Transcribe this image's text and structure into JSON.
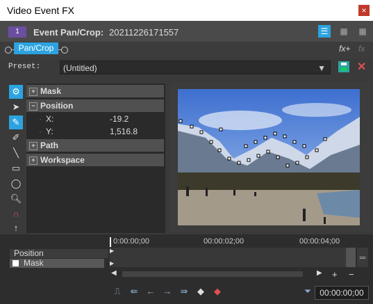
{
  "window": {
    "title": "Video Event FX",
    "close_label": "×"
  },
  "header": {
    "badge": "1",
    "effect_name": "Event Pan/Crop:",
    "event_id": "20211226171557"
  },
  "chain": {
    "button_label": "Pan/Crop",
    "fx_add": "fx+",
    "fx_remove": "fx"
  },
  "preset": {
    "label": "Preset:",
    "value": "(Untitled)",
    "arrow": "▼"
  },
  "properties": {
    "sections": [
      "Mask",
      "Position",
      "Path",
      "Workspace"
    ],
    "position": {
      "x_label": "X:",
      "x_value": "-19.2",
      "y_label": "Y:",
      "y_value": "1,516.8"
    }
  },
  "timeline": {
    "tracks": [
      "Position",
      "Mask"
    ],
    "ticks": [
      "0:00:00;00",
      "00:00:02;00",
      "00:00:04;00"
    ],
    "timecode": "00:00:00;00",
    "plus_label": "+",
    "minus_label": "−"
  },
  "colors": {
    "accent": "#2ca3e0",
    "title_bg": "#ffffff",
    "panel_bg": "#3a3a3a",
    "close_red": "#e05050"
  },
  "icons": {
    "tools": [
      "gear-icon",
      "pointer-icon",
      "pen-icon",
      "bezier-icon",
      "line-icon",
      "rectangle-icon",
      "ellipse-icon",
      "zoom-icon",
      "magnet-icon",
      "move-icon"
    ],
    "keyframe_buttons": [
      "first-keyframe-icon",
      "prev-keyframe-icon",
      "prev-icon",
      "next-icon",
      "next-keyframe-icon",
      "add-keyframe-icon",
      "delete-keyframe-icon"
    ]
  }
}
